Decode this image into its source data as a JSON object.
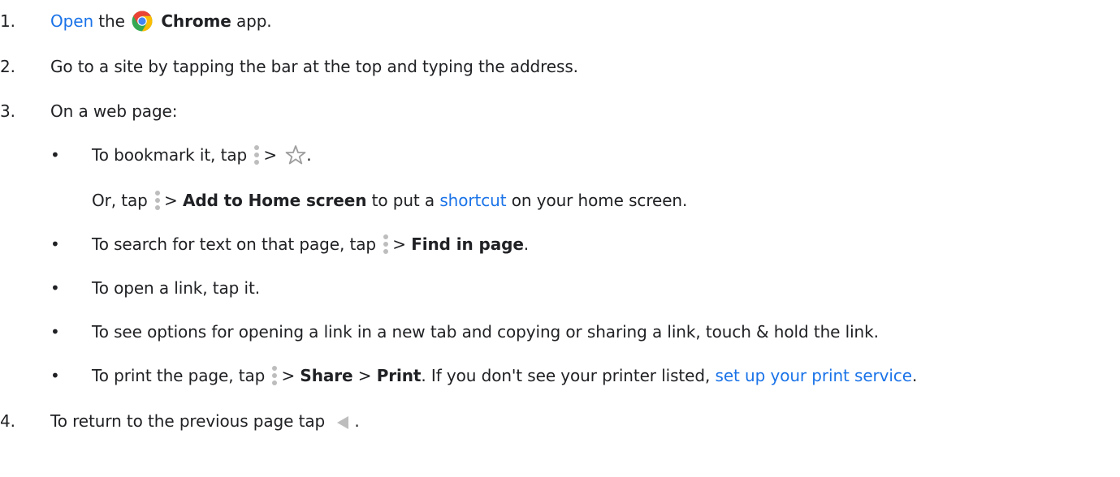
{
  "steps": [
    {
      "num": "1.",
      "link": "Open",
      "the": "the",
      "app_name": "Chrome",
      "tail": "app."
    },
    {
      "num": "2.",
      "text": "Go to a site by tapping the bar at the top and typing the address."
    },
    {
      "num": "3.",
      "text": "On a web page:"
    },
    {
      "num": "4.",
      "text": "To return to the previous page tap",
      "tail": "."
    }
  ],
  "bullets": {
    "marker": "•",
    "bookmark": {
      "text": "To bookmark it, tap",
      "gt": ">",
      "tail": "."
    },
    "home": {
      "pre": "Or, tap",
      "gt": ">",
      "bold": "Add to Home screen",
      "mid": "to put a",
      "link": "shortcut",
      "tail": "on your home screen."
    },
    "find": {
      "text": "To search for text on that page, tap",
      "gt": ">",
      "bold": "Find in page",
      "tail": "."
    },
    "open_link": {
      "text": "To open a link, tap it."
    },
    "options": {
      "text": "To see options for opening a link in a new tab and copying or sharing a link, touch & hold the link."
    },
    "print": {
      "text": "To print the page, tap",
      "gt1": ">",
      "bold1": "Share",
      "gt2": ">",
      "bold2": "Print",
      "mid": ". If you don't see your printer listed,",
      "link": "set up your print service",
      "tail": "."
    }
  },
  "icons": {
    "chrome": "chrome-logo-icon",
    "more": "more-vert-icon",
    "star": "star-outline-icon",
    "back": "back-triangle-icon"
  },
  "colors": {
    "link": "#1a73e8",
    "text": "#202124",
    "icon_gray": "#bdbdbd"
  }
}
